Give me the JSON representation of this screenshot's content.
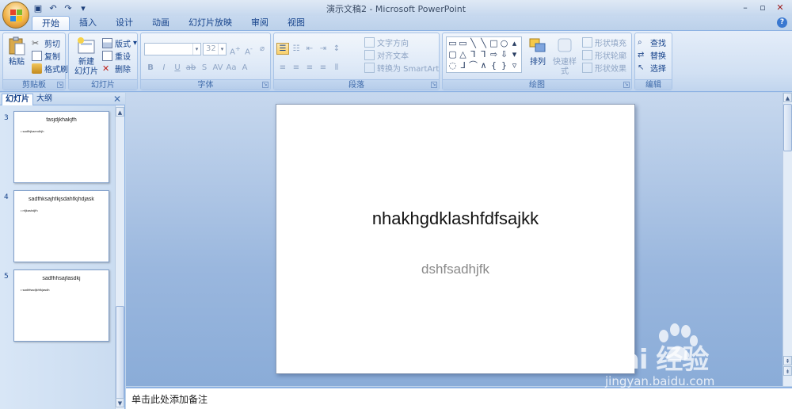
{
  "window": {
    "title": "演示文稿2 - Microsoft PowerPoint",
    "controls": [
      "–",
      "▫",
      "✕"
    ]
  },
  "tabs": [
    "开始",
    "插入",
    "设计",
    "动画",
    "幻灯片放映",
    "审阅",
    "视图"
  ],
  "ribbon": {
    "clipboard": {
      "label": "剪贴板",
      "paste": "粘贴",
      "cut": "剪切",
      "copy": "复制",
      "format_painter": "格式刷"
    },
    "slides": {
      "label": "幻灯片",
      "new_slide_line1": "新建",
      "new_slide_line2": "幻灯片",
      "layout": "版式",
      "reset": "重设",
      "delete": "删除"
    },
    "font": {
      "label": "字体",
      "font_name": "",
      "font_size": "32"
    },
    "paragraph": {
      "label": "段落",
      "text_direction": "文字方向",
      "align_text": "对齐文本",
      "convert_smartart": "转换为 SmartArt"
    },
    "drawing": {
      "label": "绘图",
      "arrange": "排列",
      "quick_styles": "快速样式",
      "shape_fill": "形状填充",
      "shape_outline": "形状轮廓",
      "shape_effects": "形状效果"
    },
    "editing": {
      "label": "编辑",
      "find": "查找",
      "replace": "替换",
      "select": "选择"
    }
  },
  "pane": {
    "tab_slides": "幻灯片",
    "tab_outline": "大纲",
    "thumbnails": [
      {
        "num": "3",
        "title": "fasjdjkhakjfh",
        "bullet": "• sadfhjkaendhjh"
      },
      {
        "num": "4",
        "title": "sadfhksajhfkjsdahfkjhdjask",
        "bullet": "• nfjkashdjfh"
      },
      {
        "num": "5",
        "title": "sadfhhsajfasdkj",
        "bullet": "• sadhfsadjkhfkjasdh"
      }
    ]
  },
  "slide": {
    "title": "nhakhgdklashfdfsajkk",
    "subtitle": "dshfsadhjfk"
  },
  "notes": {
    "placeholder": "单击此处添加备注"
  },
  "watermark": {
    "brand": "Bai 经验",
    "url": "jingyan.baidu.com"
  },
  "colors": {
    "ribbon_blue": "#15428b",
    "accent_orange": "#f0b34a"
  }
}
